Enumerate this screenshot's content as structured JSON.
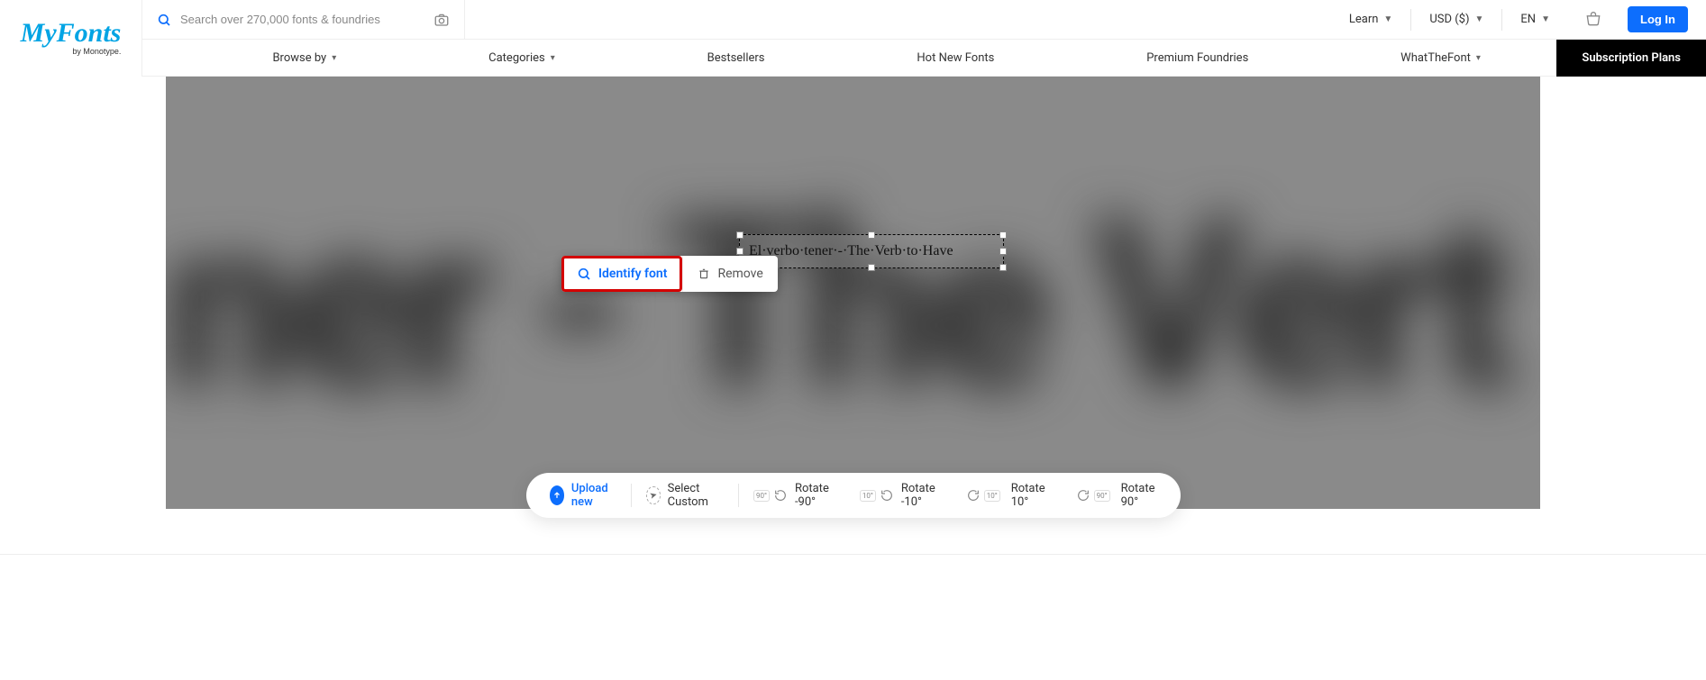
{
  "logo": {
    "main": "MyFonts",
    "sub": "by Monotype."
  },
  "search": {
    "placeholder": "Search over 270,000 fonts & foundries"
  },
  "header_right": {
    "learn": "Learn",
    "currency": "USD ($)",
    "lang": "EN",
    "login": "Log In"
  },
  "nav": {
    "browse": "Browse by",
    "categories": "Categories",
    "bestsellers": "Bestsellers",
    "hotnew": "Hot New Fonts",
    "premium": "Premium Foundries",
    "wtf": "WhatTheFont",
    "subscription": "Subscription Plans"
  },
  "canvas": {
    "blur_text": "ner - The Vert",
    "selection_text": "El·verbo·tener·-·The·Verb·to·Have"
  },
  "popover": {
    "identify": "Identify font",
    "remove": "Remove"
  },
  "toolbar": {
    "upload": "Upload new",
    "select_custom": "Select Custom",
    "rot_n90_badge": "90°",
    "rot_n90": "Rotate -90°",
    "rot_n10_badge": "10°",
    "rot_n10": "Rotate -10°",
    "rot_10_badge": "10°",
    "rot_10": "Rotate 10°",
    "rot_90_badge": "90°",
    "rot_90": "Rotate 90°"
  }
}
